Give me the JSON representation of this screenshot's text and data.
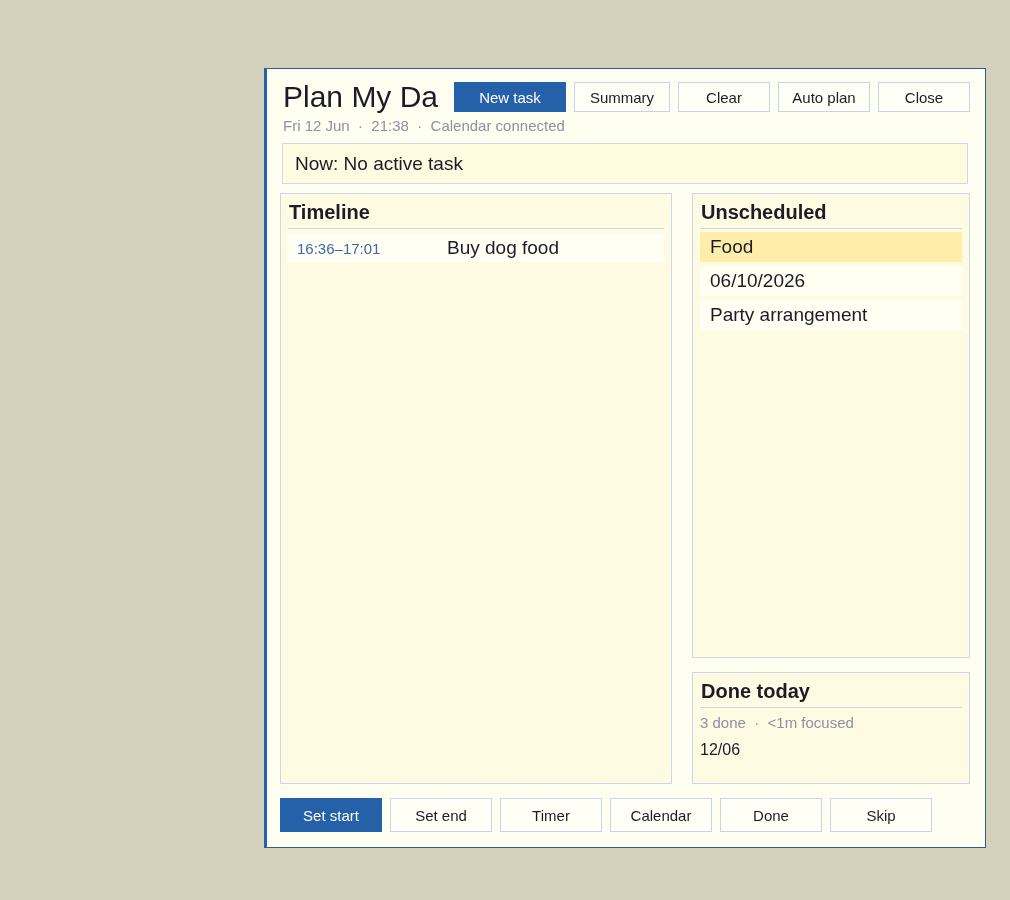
{
  "window": {
    "title": "Plan My Da",
    "subtitle": "Fri 12 Jun  ·  21:38  ·  Calendar connected"
  },
  "toolbar": [
    {
      "label": "New task",
      "kind": "primary"
    },
    {
      "label": "Summary",
      "kind": "default"
    },
    {
      "label": "Clear",
      "kind": "default"
    },
    {
      "label": "Auto plan",
      "kind": "default"
    },
    {
      "label": "Close",
      "kind": "default"
    }
  ],
  "now": {
    "text": "Now: No active task"
  },
  "timeline": {
    "heading": "Timeline",
    "rows": [
      {
        "time": "16:36–17:01",
        "title": "Buy dog food"
      }
    ]
  },
  "unscheduled": {
    "heading": "Unscheduled",
    "items": [
      {
        "label": "Food",
        "selected": true
      },
      {
        "label": "06/10/2026",
        "selected": false
      },
      {
        "label": "Party arrangement",
        "selected": false
      }
    ]
  },
  "done_today": {
    "heading": "Done today",
    "stats": "3 done  ·  <1m focused",
    "items": [
      "12/06"
    ]
  },
  "actions": [
    {
      "label": "Set start",
      "kind": "primary"
    },
    {
      "label": "Set end",
      "kind": "default"
    },
    {
      "label": "Timer",
      "kind": "default"
    },
    {
      "label": "Calendar",
      "kind": "default"
    },
    {
      "label": "Done",
      "kind": "default"
    },
    {
      "label": "Skip",
      "kind": "default"
    }
  ]
}
